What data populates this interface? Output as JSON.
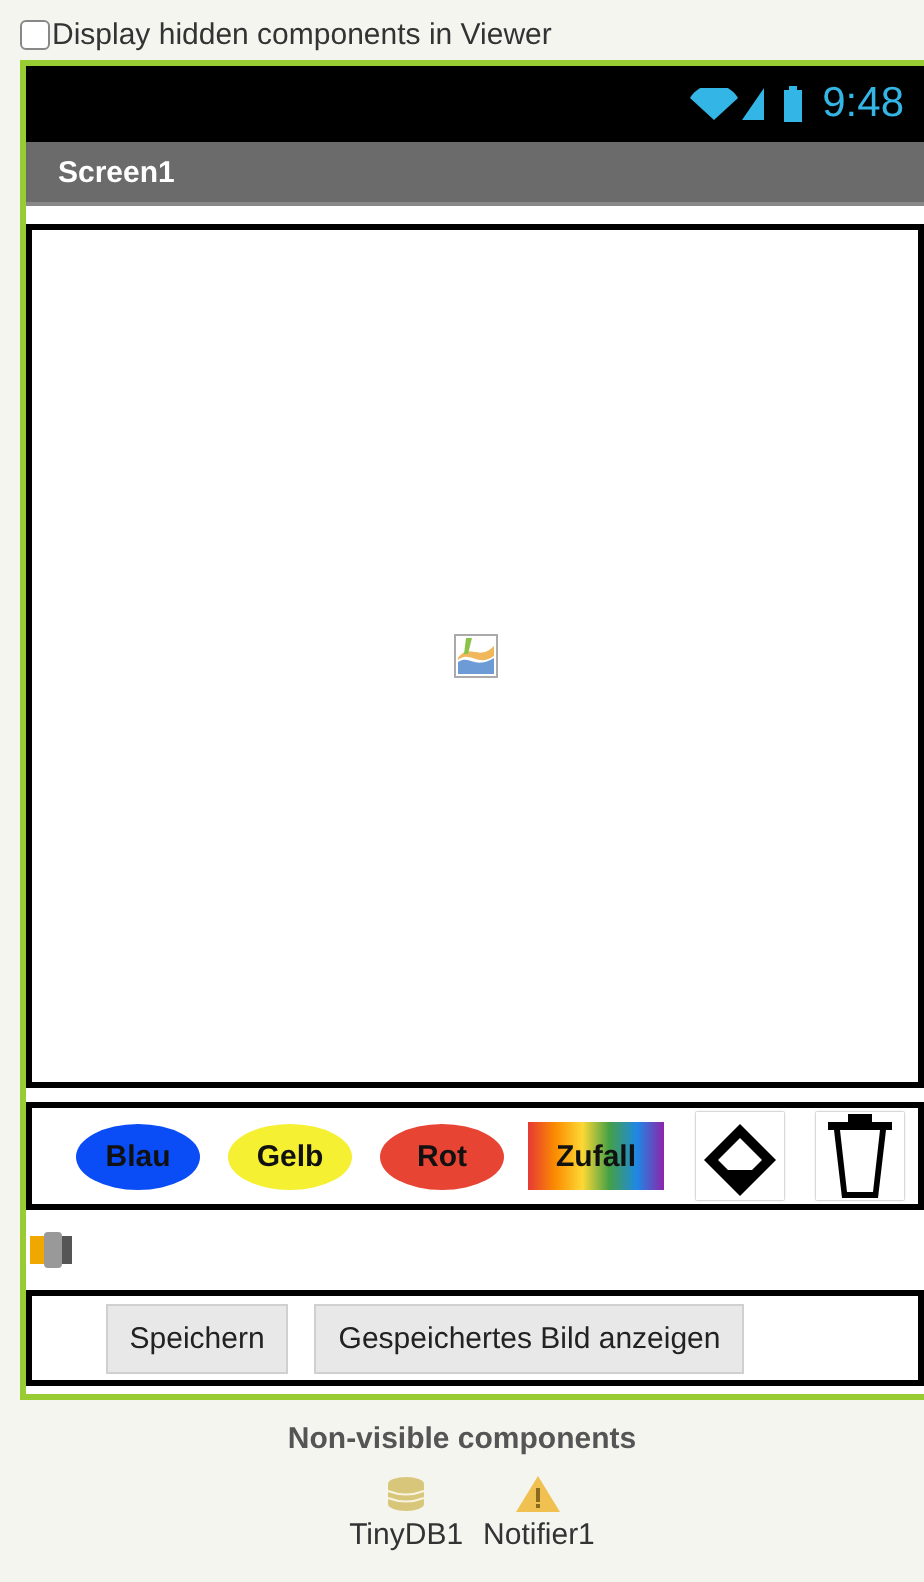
{
  "hidden_toggle": {
    "label": "Display hidden components in Viewer",
    "checked": false
  },
  "status_bar": {
    "time": "9:48"
  },
  "screen": {
    "title": "Screen1"
  },
  "color_buttons": [
    {
      "kind": "oval",
      "label": "Blau",
      "color": "#0a4cf5"
    },
    {
      "kind": "oval",
      "label": "Gelb",
      "color": "#f5f031"
    },
    {
      "kind": "oval",
      "label": "Rot",
      "color": "#e84434"
    },
    {
      "kind": "rainbow",
      "label": "Zufall"
    },
    {
      "kind": "eraser"
    },
    {
      "kind": "trash"
    }
  ],
  "action_buttons": [
    {
      "label": "Speichern"
    },
    {
      "label": "Gespeichertes Bild anzeigen"
    }
  ],
  "non_visible": {
    "title": "Non-visible components",
    "items": [
      {
        "kind": "database",
        "label": "TinyDB1"
      },
      {
        "kind": "warning",
        "label": "Notifier1"
      }
    ]
  }
}
